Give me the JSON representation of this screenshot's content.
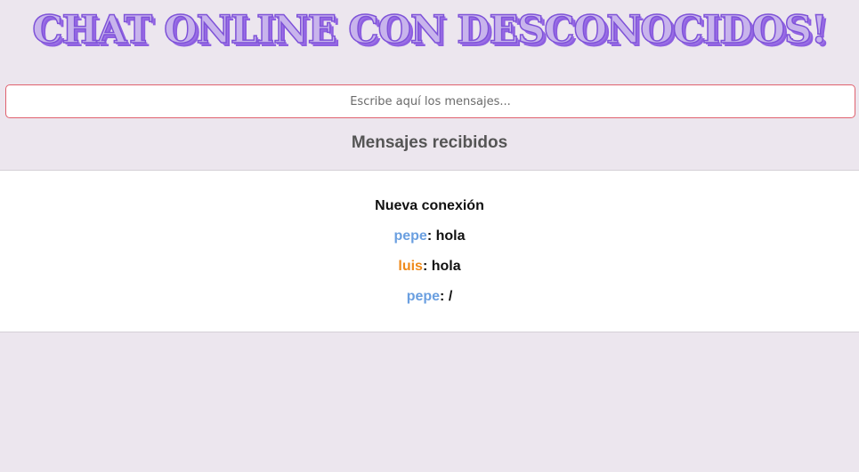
{
  "header": {
    "title": "CHAT ONLINE CON DESCONOCIDOS!"
  },
  "composer": {
    "placeholder": "Escribe aquí los mensajes...",
    "value": ""
  },
  "received": {
    "heading": "Mensajes recibidos",
    "messages": [
      {
        "type": "system",
        "text": "Nueva conexión"
      },
      {
        "type": "chat",
        "user": "pepe",
        "separator": ": ",
        "text": "hola",
        "user_color": "#6a9fe0"
      },
      {
        "type": "chat",
        "user": "luis",
        "separator": ": ",
        "text": "hola",
        "user_color": "#ef8a1a"
      },
      {
        "type": "chat",
        "user": "pepe",
        "separator": ": ",
        "text": "/",
        "user_color": "#6a9fe0"
      }
    ]
  },
  "colors": {
    "page_bg": "#ece6ee",
    "title_fill": "#c8b4ec",
    "title_stroke": "#7e52d8",
    "input_border": "#e0616e"
  }
}
